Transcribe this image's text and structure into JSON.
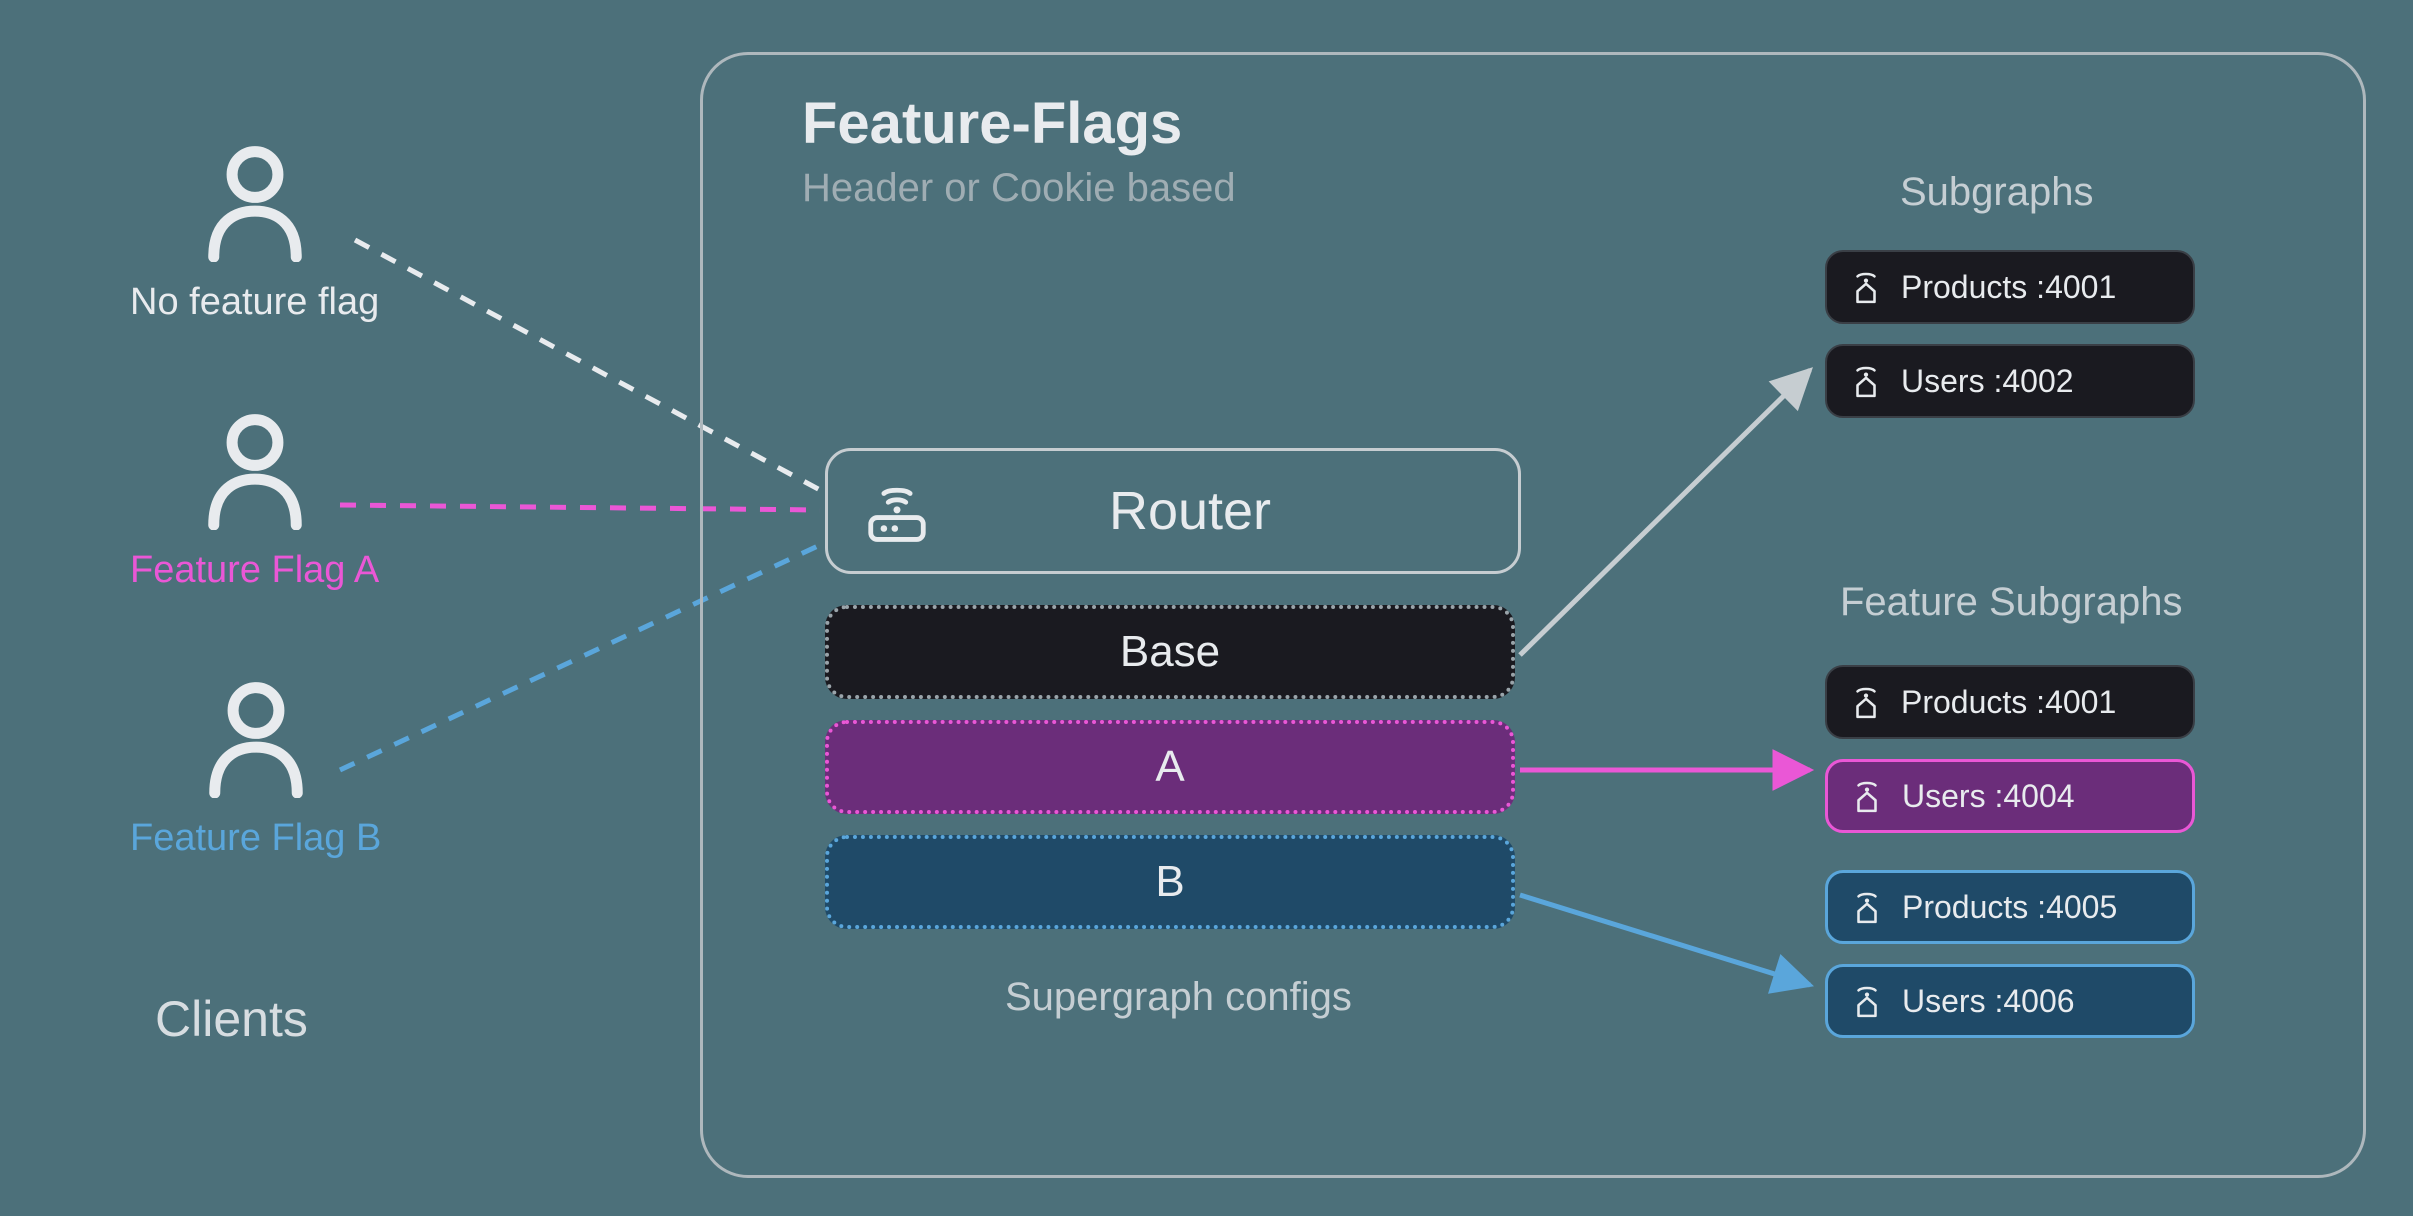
{
  "clients": {
    "title": "Clients",
    "items": [
      {
        "label": "No feature flag",
        "color_class": "label-white"
      },
      {
        "label": "Feature Flag A",
        "color_class": "label-pink"
      },
      {
        "label": "Feature Flag B",
        "color_class": "label-blue"
      }
    ]
  },
  "feature_flags": {
    "title": "Feature-Flags",
    "subtitle": "Header or Cookie based"
  },
  "router": {
    "label": "Router"
  },
  "configs": {
    "label": "Supergraph configs",
    "items": [
      {
        "id": "base",
        "label": "Base"
      },
      {
        "id": "a",
        "label": "A"
      },
      {
        "id": "b",
        "label": "B"
      }
    ]
  },
  "subgraphs": {
    "title": "Subgraphs",
    "items": [
      {
        "label": "Products :4001"
      },
      {
        "label": "Users :4002"
      }
    ]
  },
  "feature_subgraphs": {
    "title": "Feature Subgraphs",
    "items": [
      {
        "label": "Products :4001",
        "variant": "chip-dark"
      },
      {
        "label": "Users :4004",
        "variant": "chip-purple"
      },
      {
        "label": "Products :4005",
        "variant": "chip-blue"
      },
      {
        "label": "Users :4006",
        "variant": "chip-blue"
      }
    ]
  },
  "colors": {
    "bg": "#4c707a",
    "white": "#e8ebee",
    "pink": "#ea57d6",
    "blue": "#5aa6db",
    "gray": "#9fadb3"
  }
}
